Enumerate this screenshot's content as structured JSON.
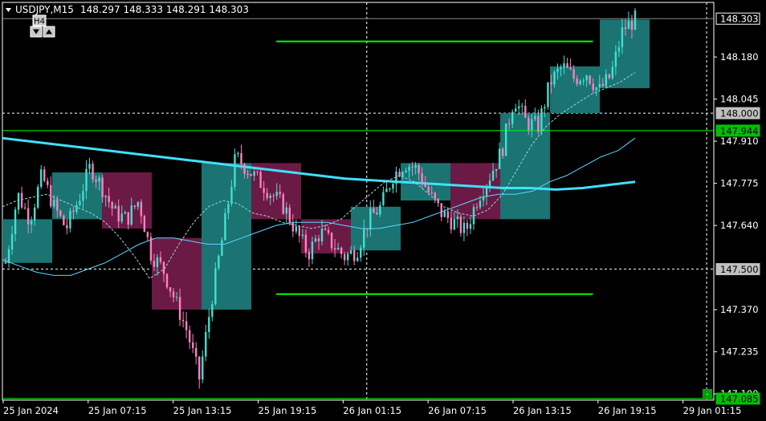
{
  "header": {
    "symbol": "USDJPY,M15",
    "ohlc": "148.297 148.333 148.291 148.303",
    "tf_button": "H4"
  },
  "colors": {
    "background": "#000000",
    "bull_candle": "#40e0d0",
    "bear_candle": "#ff80c0",
    "bull_box": "#1b7372",
    "bear_box": "#6b1a45",
    "ma_slow": "#40e0ff",
    "ma_mid": "#5fd6ff",
    "level_line": "#00ff00",
    "axis_text": "#ffffff"
  },
  "chart_data": {
    "type": "candlestick",
    "y_ticks": [
      "148.180",
      "148.045",
      "147.910",
      "147.775",
      "147.640",
      "147.370",
      "147.235",
      "147.100"
    ],
    "x_ticks": [
      "25 Jan 2024",
      "25 Jan 07:15",
      "25 Jan 13:15",
      "25 Jan 19:15",
      "26 Jan 01:15",
      "26 Jan 07:15",
      "26 Jan 13:15",
      "26 Jan 19:15",
      "29 Jan 01:15"
    ],
    "ylim": [
      147.08,
      148.355
    ],
    "price_labels": [
      {
        "value": 148.303,
        "text": "148.303",
        "style": "current"
      },
      {
        "value": 148.0,
        "text": "148.000",
        "style": "gray"
      },
      {
        "value": 147.944,
        "text": "147.944",
        "style": "green"
      },
      {
        "value": 147.5,
        "text": "147.500",
        "style": "gray"
      },
      {
        "value": 147.085,
        "text": "147.085",
        "style": "green"
      }
    ],
    "horizontal_dotted_levels": [
      148.0,
      147.5
    ],
    "green_levels": [
      {
        "value": 148.23,
        "segment": [
          0.385,
          0.83
        ]
      },
      {
        "value": 147.944,
        "segment": [
          0.0,
          1.0
        ]
      },
      {
        "value": 147.42,
        "segment": [
          0.385,
          0.83
        ]
      },
      {
        "value": 147.085,
        "segment": [
          0.0,
          1.0
        ]
      }
    ],
    "vertical_dotted_indices": [
      4,
      8
    ],
    "h4_boxes": [
      {
        "o": 147.66,
        "c": 147.52,
        "h": 147.7,
        "l": 147.5,
        "bull": true
      },
      {
        "o": 147.66,
        "c": 147.81,
        "h": 147.86,
        "l": 147.64,
        "bull": true
      },
      {
        "o": 147.81,
        "c": 147.63,
        "h": 147.84,
        "l": 147.55,
        "bull": false
      },
      {
        "o": 147.6,
        "c": 147.37,
        "h": 147.64,
        "l": 147.3,
        "bull": false
      },
      {
        "o": 147.37,
        "c": 147.84,
        "h": 147.95,
        "l": 147.13,
        "bull": true
      },
      {
        "o": 147.84,
        "c": 147.66,
        "h": 147.86,
        "l": 147.6,
        "bull": false
      },
      {
        "o": 147.66,
        "c": 147.55,
        "h": 147.8,
        "l": 147.52,
        "bull": false
      },
      {
        "o": 147.56,
        "c": 147.7,
        "h": 147.78,
        "l": 147.52,
        "bull": true
      },
      {
        "o": 147.72,
        "c": 147.84,
        "h": 148.1,
        "l": 147.7,
        "bull": true
      },
      {
        "o": 147.84,
        "c": 147.66,
        "h": 147.85,
        "l": 147.42,
        "bull": false
      },
      {
        "o": 147.66,
        "c": 148.0,
        "h": 148.2,
        "l": 147.64,
        "bull": true
      },
      {
        "o": 148.0,
        "c": 148.15,
        "h": 148.2,
        "l": 147.9,
        "bull": true
      },
      {
        "o": 148.08,
        "c": 148.3,
        "h": 148.33,
        "l": 148.02,
        "bull": true
      }
    ],
    "close_path": [
      147.52,
      147.74,
      147.66,
      147.8,
      147.7,
      147.63,
      147.72,
      147.83,
      147.76,
      147.68,
      147.66,
      147.72,
      147.55,
      147.5,
      147.4,
      147.3,
      147.15,
      147.4,
      147.62,
      147.86,
      147.82,
      147.78,
      147.74,
      147.7,
      147.62,
      147.55,
      147.62,
      147.58,
      147.54,
      147.56,
      147.66,
      147.7,
      147.8,
      147.84,
      147.82,
      147.74,
      147.68,
      147.65,
      147.62,
      147.73,
      147.8,
      147.88,
      148.05,
      147.97,
      147.96,
      148.1,
      148.15,
      148.11,
      148.13,
      148.07,
      148.12,
      148.27,
      148.3
    ],
    "ma_fast": [
      147.7,
      147.72,
      147.73,
      147.74,
      147.72,
      147.7,
      147.68,
      147.65,
      147.6,
      147.54,
      147.47,
      147.5,
      147.58,
      147.65,
      147.7,
      147.72,
      147.71,
      147.68,
      147.67,
      147.65,
      147.64,
      147.63,
      147.64,
      147.66,
      147.7,
      147.74,
      147.78,
      147.8,
      147.78,
      147.74,
      147.7,
      147.68,
      147.67,
      147.69,
      147.74,
      147.82,
      147.9,
      147.96,
      148.0,
      148.03,
      148.06,
      148.08,
      148.1,
      148.13
    ],
    "ma_mid": [
      147.53,
      147.51,
      147.49,
      147.48,
      147.48,
      147.5,
      147.52,
      147.55,
      147.58,
      147.6,
      147.6,
      147.59,
      147.58,
      147.58,
      147.6,
      147.62,
      147.64,
      147.65,
      147.65,
      147.65,
      147.64,
      147.63,
      147.63,
      147.64,
      147.65,
      147.67,
      147.69,
      147.71,
      147.73,
      147.74,
      147.74,
      147.75,
      147.78,
      147.8,
      147.83,
      147.86,
      147.88,
      147.92
    ],
    "ma_slow": [
      147.92,
      147.91,
      147.9,
      147.89,
      147.88,
      147.87,
      147.86,
      147.85,
      147.84,
      147.83,
      147.82,
      147.81,
      147.8,
      147.79,
      147.785,
      147.78,
      147.775,
      147.77,
      147.765,
      147.76,
      147.76,
      147.755,
      147.76,
      147.77,
      147.78
    ]
  }
}
